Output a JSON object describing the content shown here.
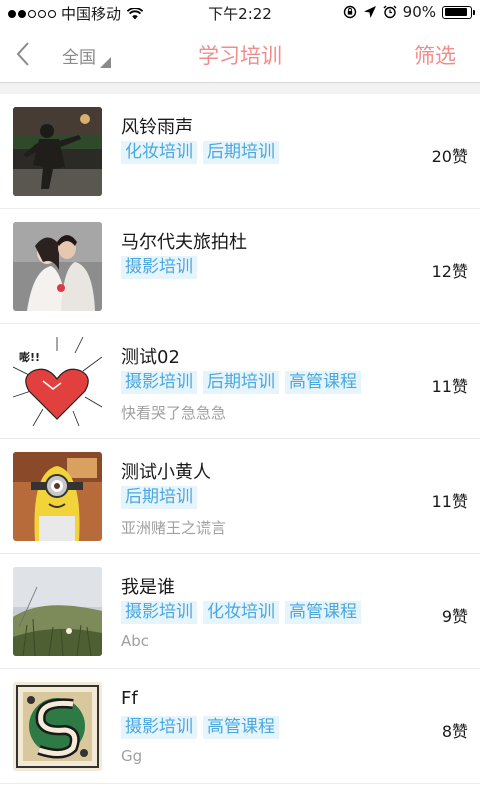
{
  "status_bar": {
    "carrier": "中国移动",
    "time": "下午2:22",
    "battery": "90%",
    "battery_level": 0.9
  },
  "nav": {
    "back_icon": "chevron-left-icon",
    "region": "全国",
    "title": "学习培训",
    "filter": "筛选"
  },
  "items": [
    {
      "title": "风铃雨声",
      "tags": [
        "化妆培训",
        "后期培训"
      ],
      "subtitle": "",
      "likes": "20赞"
    },
    {
      "title": "马尔代夫旅拍杜",
      "tags": [
        "摄影培训"
      ],
      "subtitle": "",
      "likes": "12赞"
    },
    {
      "title": "测试02",
      "tags": [
        "摄影培训",
        "后期培训",
        "高管课程"
      ],
      "subtitle": "快看哭了急急急",
      "likes": "11赞"
    },
    {
      "title": "测试小黄人",
      "tags": [
        "后期培训"
      ],
      "subtitle": "亚洲赌王之谎言",
      "likes": "11赞"
    },
    {
      "title": "我是谁",
      "tags": [
        "摄影培训",
        "化妆培训",
        "高管课程"
      ],
      "subtitle": "Abc",
      "likes": "9赞"
    },
    {
      "title": "Ff",
      "tags": [
        "摄影培训",
        "高管课程"
      ],
      "subtitle": "Gg",
      "likes": "8赞"
    }
  ],
  "colors": {
    "accent": "#f08c8c",
    "tag_text": "#4aa8df",
    "tag_bg": "#e6f4fb"
  }
}
